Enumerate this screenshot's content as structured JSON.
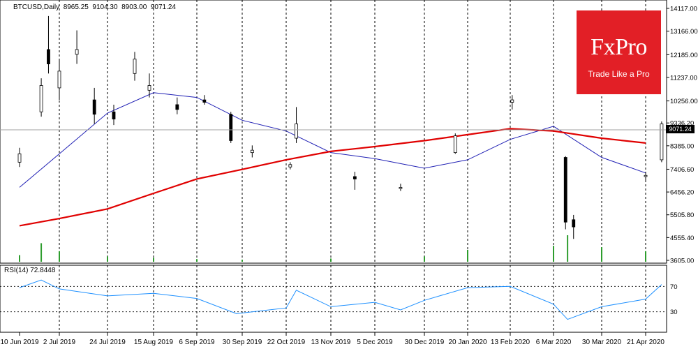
{
  "header": {
    "symbol": "BTCUSD,Daily",
    "open": "8965.25",
    "high": "9104.30",
    "low": "8903.00",
    "close": "9071.24"
  },
  "brand": {
    "name": "FxPro",
    "tagline": "Trade Like a Pro",
    "color": "#e21f26"
  },
  "rsi": {
    "title": "RSI(14) 72.8448",
    "levels": [
      "70",
      "30"
    ]
  },
  "current_price_label": "9071.24",
  "chart_data": {
    "type": "candlestick",
    "price_axis": {
      "min": 3605,
      "max": 14117,
      "ticks": [
        "14117.00",
        "13166.00",
        "12185.00",
        "11237.00",
        "10256.00",
        "9336.20",
        "8385.00",
        "7406.60",
        "6456.20",
        "5505.80",
        "4555.40",
        "3605.00"
      ]
    },
    "date_labels": [
      "10 Jun 2019",
      "2 Jul 2019",
      "24 Jul 2019",
      "15 Aug 2019",
      "6 Sep 2019",
      "30 Sep 2019",
      "22 Oct 2019",
      "13 Nov 2019",
      "5 Dec 2019",
      "30 Dec 2019",
      "20 Jan 2020",
      "13 Feb 2020",
      "6 Mar 2020",
      "30 Mar 2020",
      "21 Apr 2020"
    ],
    "candles": [
      {
        "date": "10 Jun 2019",
        "open": 7700,
        "high": 8300,
        "low": 7500,
        "close": 8050
      },
      {
        "date": "22 Jun 2019",
        "open": 9800,
        "high": 11200,
        "low": 9600,
        "close": 10900
      },
      {
        "date": "26 Jun 2019",
        "open": 12400,
        "high": 13800,
        "low": 11400,
        "close": 11800
      },
      {
        "date": "2 Jul 2019",
        "open": 10800,
        "high": 12000,
        "low": 10300,
        "close": 11500
      },
      {
        "date": "10 Jul 2019",
        "open": 12200,
        "high": 13200,
        "low": 11800,
        "close": 12400
      },
      {
        "date": "18 Jul 2019",
        "open": 10300,
        "high": 10800,
        "low": 9300,
        "close": 9700
      },
      {
        "date": "27 Jul 2019",
        "open": 9800,
        "high": 10100,
        "low": 9250,
        "close": 9500
      },
      {
        "date": "6 Aug 2019",
        "open": 11400,
        "high": 12300,
        "low": 11100,
        "close": 12000
      },
      {
        "date": "13 Aug 2019",
        "open": 10700,
        "high": 11400,
        "low": 10400,
        "close": 10900
      },
      {
        "date": "27 Aug 2019",
        "open": 10100,
        "high": 10400,
        "low": 9700,
        "close": 9900
      },
      {
        "date": "10 Sep 2019",
        "open": 10300,
        "high": 10500,
        "low": 10100,
        "close": 10200
      },
      {
        "date": "24 Sep 2019",
        "open": 9700,
        "high": 9800,
        "low": 8500,
        "close": 8600
      },
      {
        "date": "5 Oct 2019",
        "open": 8100,
        "high": 8400,
        "low": 7900,
        "close": 8200
      },
      {
        "date": "24 Oct 2019",
        "open": 7500,
        "high": 7700,
        "low": 7400,
        "close": 7600
      },
      {
        "date": "27 Oct 2019",
        "open": 8700,
        "high": 10000,
        "low": 8500,
        "close": 9300
      },
      {
        "date": "25 Nov 2019",
        "open": 7100,
        "high": 7300,
        "low": 6550,
        "close": 7000
      },
      {
        "date": "18 Dec 2019",
        "open": 6600,
        "high": 6800,
        "low": 6500,
        "close": 6650
      },
      {
        "date": "14 Jan 2020",
        "open": 8100,
        "high": 8900,
        "low": 8050,
        "close": 8800
      },
      {
        "date": "14 Feb 2020",
        "open": 10200,
        "high": 10500,
        "low": 9900,
        "close": 10300
      },
      {
        "date": "12 Mar 2020",
        "open": 7900,
        "high": 7950,
        "low": 4900,
        "close": 5200
      },
      {
        "date": "16 Mar 2020",
        "open": 5300,
        "high": 5500,
        "low": 4500,
        "close": 5000
      },
      {
        "date": "21 Apr 2020",
        "open": 7100,
        "high": 7300,
        "low": 6900,
        "close": 7150
      },
      {
        "date": "29 Apr 2020",
        "open": 7800,
        "high": 9400,
        "low": 7700,
        "close": 9300
      }
    ],
    "overlays": [
      {
        "color": "#1f1fb4",
        "points": [
          {
            "date": "10 Jun 2019",
            "value": 6650
          },
          {
            "date": "2 Jul 2019",
            "value": 8050
          },
          {
            "date": "24 Jul 2019",
            "value": 9750
          },
          {
            "date": "15 Aug 2019",
            "value": 10600
          },
          {
            "date": "6 Sep 2019",
            "value": 10400
          },
          {
            "date": "30 Sep 2019",
            "value": 9450
          },
          {
            "date": "22 Oct 2019",
            "value": 9000
          },
          {
            "date": "13 Nov 2019",
            "value": 8100
          },
          {
            "date": "5 Dec 2019",
            "value": 7850
          },
          {
            "date": "30 Dec 2019",
            "value": 7450
          },
          {
            "date": "20 Jan 2020",
            "value": 7800
          },
          {
            "date": "13 Feb 2020",
            "value": 8650
          },
          {
            "date": "6 Mar 2020",
            "value": 9200
          },
          {
            "date": "30 Mar 2020",
            "value": 7900
          },
          {
            "date": "21 Apr 2020",
            "value": 7250
          }
        ]
      },
      {
        "color": "#e00000",
        "points": [
          {
            "date": "10 Jun 2019",
            "value": 5050
          },
          {
            "date": "2 Jul 2019",
            "value": 5350
          },
          {
            "date": "24 Jul 2019",
            "value": 5750
          },
          {
            "date": "15 Aug 2019",
            "value": 6400
          },
          {
            "date": "6 Sep 2019",
            "value": 7000
          },
          {
            "date": "30 Sep 2019",
            "value": 7400
          },
          {
            "date": "22 Oct 2019",
            "value": 7800
          },
          {
            "date": "13 Nov 2019",
            "value": 8150
          },
          {
            "date": "5 Dec 2019",
            "value": 8350
          },
          {
            "date": "30 Dec 2019",
            "value": 8600
          },
          {
            "date": "20 Jan 2020",
            "value": 8850
          },
          {
            "date": "13 Feb 2020",
            "value": 9100
          },
          {
            "date": "6 Mar 2020",
            "value": 9000
          },
          {
            "date": "30 Mar 2020",
            "value": 8700
          },
          {
            "date": "21 Apr 2020",
            "value": 8500
          }
        ]
      }
    ],
    "rsi_series": [
      {
        "date": "10 Jun 2019",
        "value": 68
      },
      {
        "date": "22 Jun 2019",
        "value": 80
      },
      {
        "date": "2 Jul 2019",
        "value": 66
      },
      {
        "date": "24 Jul 2019",
        "value": 55
      },
      {
        "date": "15 Aug 2019",
        "value": 59
      },
      {
        "date": "6 Sep 2019",
        "value": 51
      },
      {
        "date": "27 Sep 2019",
        "value": 27
      },
      {
        "date": "22 Oct 2019",
        "value": 36
      },
      {
        "date": "27 Oct 2019",
        "value": 64
      },
      {
        "date": "13 Nov 2019",
        "value": 38
      },
      {
        "date": "5 Dec 2019",
        "value": 45
      },
      {
        "date": "18 Dec 2019",
        "value": 33
      },
      {
        "date": "30 Dec 2019",
        "value": 48
      },
      {
        "date": "20 Jan 2020",
        "value": 68
      },
      {
        "date": "13 Feb 2020",
        "value": 70
      },
      {
        "date": "6 Mar 2020",
        "value": 42
      },
      {
        "date": "13 Mar 2020",
        "value": 18
      },
      {
        "date": "30 Mar 2020",
        "value": 38
      },
      {
        "date": "21 Apr 2020",
        "value": 50
      },
      {
        "date": "29 Apr 2020",
        "value": 73
      }
    ],
    "volume": [
      {
        "date": "10 Jun 2019",
        "value": 25
      },
      {
        "date": "22 Jun 2019",
        "value": 70
      },
      {
        "date": "2 Jul 2019",
        "value": 40
      },
      {
        "date": "24 Jul 2019",
        "value": 20
      },
      {
        "date": "15 Aug 2019",
        "value": 15
      },
      {
        "date": "6 Sep 2019",
        "value": 10
      },
      {
        "date": "30 Sep 2019",
        "value": 8
      },
      {
        "date": "13 Nov 2019",
        "value": 12
      },
      {
        "date": "30 Dec 2019",
        "value": 20
      },
      {
        "date": "20 Jan 2020",
        "value": 45
      },
      {
        "date": "6 Mar 2020",
        "value": 60
      },
      {
        "date": "13 Mar 2020",
        "value": 100
      },
      {
        "date": "30 Mar 2020",
        "value": 55
      },
      {
        "date": "21 Apr 2020",
        "value": 40
      }
    ],
    "grid": true
  }
}
